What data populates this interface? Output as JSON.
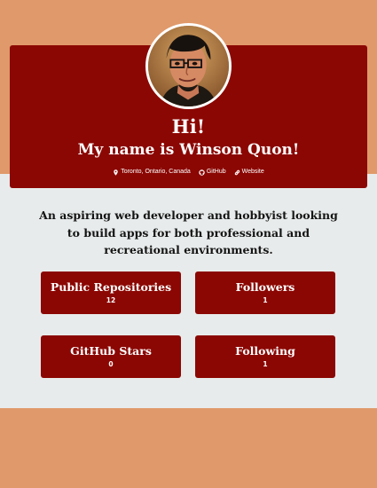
{
  "profile": {
    "greeting": "Hi!",
    "name_line": "My name is Winson Quon!",
    "avatar_alt": "Profile photo of Winson Quon"
  },
  "meta": {
    "location": "Toronto, Ontario, Canada",
    "github": "GitHub",
    "website": "Website"
  },
  "bio": "An aspiring web developer and hobbyist looking to build apps for both professional and recreational environments.",
  "stats": [
    {
      "label": "Public Repositories",
      "value": "12"
    },
    {
      "label": "Followers",
      "value": "1"
    },
    {
      "label": "GitHub Stars",
      "value": "0"
    },
    {
      "label": "Following",
      "value": "1"
    }
  ],
  "colors": {
    "background": "#e0996a",
    "band": "#e8ebeb",
    "card": "#8b0703",
    "text_dark": "#141414",
    "text_light": "#ffffff"
  },
  "icons": {
    "location": "map-marker-icon",
    "github": "github-icon",
    "website": "link-icon"
  }
}
